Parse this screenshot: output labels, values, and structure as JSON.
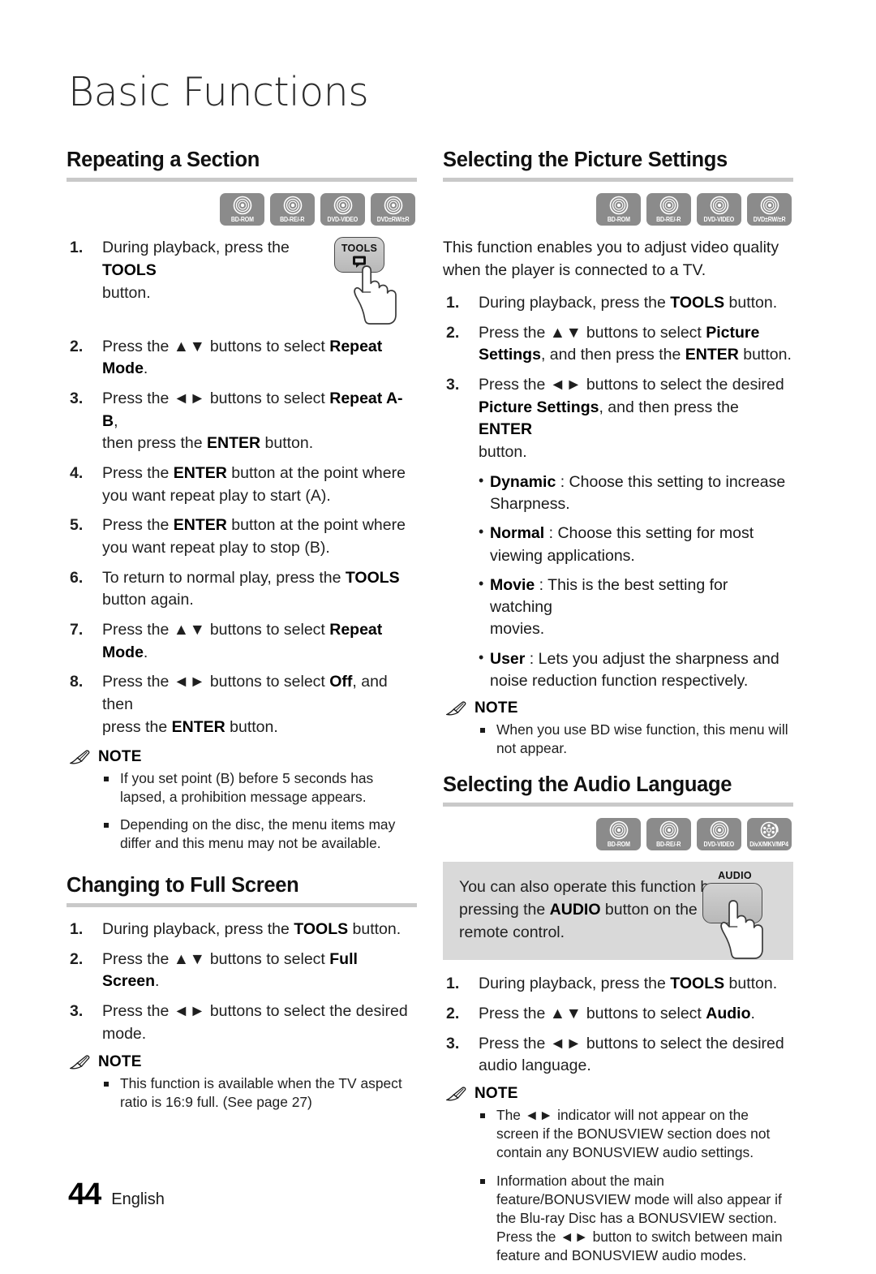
{
  "chapter": {
    "title": "Basic Functions"
  },
  "footer": {
    "page_number": "44",
    "language": "English"
  },
  "colors": {
    "disc_badge_bg": "#8b8b8b",
    "rule": "#c9c9c9",
    "callout_bg": "#d9d9d9"
  },
  "note_label": "NOTE",
  "discs": {
    "video": [
      {
        "id": "bd-rom",
        "label": "BD-ROM",
        "glyph": "disc-icon"
      },
      {
        "id": "bd-re-r",
        "label": "BD-RE/-R",
        "glyph": "disc-icon"
      },
      {
        "id": "dvd-video",
        "label": "DVD-VIDEO",
        "glyph": "disc-icon"
      },
      {
        "id": "dvd-rw-r",
        "label": "DVD±RW/±R",
        "glyph": "disc-icon"
      }
    ],
    "audio": [
      {
        "id": "bd-rom",
        "label": "BD-ROM",
        "glyph": "disc-icon"
      },
      {
        "id": "bd-re-r",
        "label": "BD-RE/-R",
        "glyph": "disc-icon"
      },
      {
        "id": "dvd-video",
        "label": "DVD-VIDEO",
        "glyph": "disc-icon"
      },
      {
        "id": "divx-mkv-mp4",
        "label": "DivX/MKV/MP4",
        "glyph": "film-reel-icon"
      }
    ]
  },
  "sections": {
    "repeating": {
      "heading": "Repeating a Section",
      "steps": [
        {
          "num": "1.",
          "html": "During playback, press the <b>TOOLS</b><br>button."
        },
        {
          "num": "2.",
          "html": "Press the <span class=\"arrows\">▲▼</span> buttons to select <b>Repeat Mode</b>."
        },
        {
          "num": "3.",
          "html": "Press the <span class=\"arrows\">◄►</span> buttons to select <b>Repeat A-B</b>,<br>then press the <b>ENTER</b> button."
        },
        {
          "num": "4.",
          "html": "Press the <b>ENTER</b> button at the point where<br>you want repeat play to start (A)."
        },
        {
          "num": "5.",
          "html": "Press the <b>ENTER</b> button at the point where<br>you want repeat play to stop (B)."
        },
        {
          "num": "6.",
          "html": "To return to normal play, press the <b>TOOLS</b><br>button again."
        },
        {
          "num": "7.",
          "html": "Press the <span class=\"arrows\">▲▼</span> buttons to select <b>Repeat Mode</b>."
        },
        {
          "num": "8.",
          "html": "Press the <span class=\"arrows\">◄►</span> buttons to select <b>Off</b>, and then<br>press the <b>ENTER</b> button."
        }
      ],
      "tools_key_label": "TOOLS",
      "notes": [
        "If you set point (B) before 5 seconds has lapsed, a prohibition message appears.",
        "Depending on the disc, the menu items may differ and this menu may not be available."
      ]
    },
    "fullscreen": {
      "heading": "Changing to Full Screen",
      "steps": [
        {
          "num": "1.",
          "html": "During playback, press the <b>TOOLS</b> button."
        },
        {
          "num": "2.",
          "html": "Press the <span class=\"arrows\">▲▼</span> buttons to select <b>Full Screen</b>."
        },
        {
          "num": "3.",
          "html": "Press the <span class=\"arrows\">◄►</span> buttons to select the desired<br>mode."
        }
      ],
      "notes": [
        "This function is available when the TV aspect ratio is 16:9 full. (See page 27)"
      ]
    },
    "picture": {
      "heading": "Selecting the Picture Settings",
      "intro": "This function enables you to adjust video quality when the player is connected to a TV.",
      "steps": [
        {
          "num": "1.",
          "html": "During playback, press the <b>TOOLS</b> button."
        },
        {
          "num": "2.",
          "html": "Press the <span class=\"arrows\">▲▼</span> buttons to select <b>Picture<br>Settings</b>, and then press the <b>ENTER</b> button."
        },
        {
          "num": "3.",
          "html": "Press the <span class=\"arrows\">◄►</span> buttons to select the desired<br><b>Picture Settings</b>, and then press the <b>ENTER</b><br>button."
        }
      ],
      "options": [
        {
          "name": "Dynamic",
          "html": "<b>Dynamic</b> : Choose this setting to increase<br>Sharpness."
        },
        {
          "name": "Normal",
          "html": "<b>Normal</b> : Choose this setting for most<br>viewing applications."
        },
        {
          "name": "Movie",
          "html": "<b>Movie</b> : This is the best setting for watching<br>movies."
        },
        {
          "name": "User",
          "html": "<b>User</b> : Lets you adjust the sharpness and<br>noise reduction function respectively."
        }
      ],
      "notes": [
        "When you use BD wise function, this menu will not appear."
      ]
    },
    "audio_language": {
      "heading": "Selecting the Audio Language",
      "tip": {
        "html": "You can also operate this function by pressing the <b>AUDIO</b> button on the remote control.",
        "key_label": "AUDIO"
      },
      "steps": [
        {
          "num": "1.",
          "html": "During playback, press the <b>TOOLS</b> button."
        },
        {
          "num": "2.",
          "html": "Press the <span class=\"arrows\">▲▼</span> buttons to select <b>Audio</b>."
        },
        {
          "num": "3.",
          "html": "Press the <span class=\"arrows\">◄►</span> buttons to select the desired<br>audio language."
        }
      ],
      "notes": [
        "The <span class=\"arrows\">◄►</span> indicator will not appear on the screen if the BONUSVIEW section does not contain any BONUSVIEW audio settings.",
        "Information about the main feature/BONUSVIEW mode will also appear if the Blu-ray Disc has a BONUSVIEW section.<span class=\"cont\">Press the <span class=\"arrows\">◄►</span> button to switch between main feature and BONUSVIEW audio modes.</span>"
      ]
    }
  }
}
